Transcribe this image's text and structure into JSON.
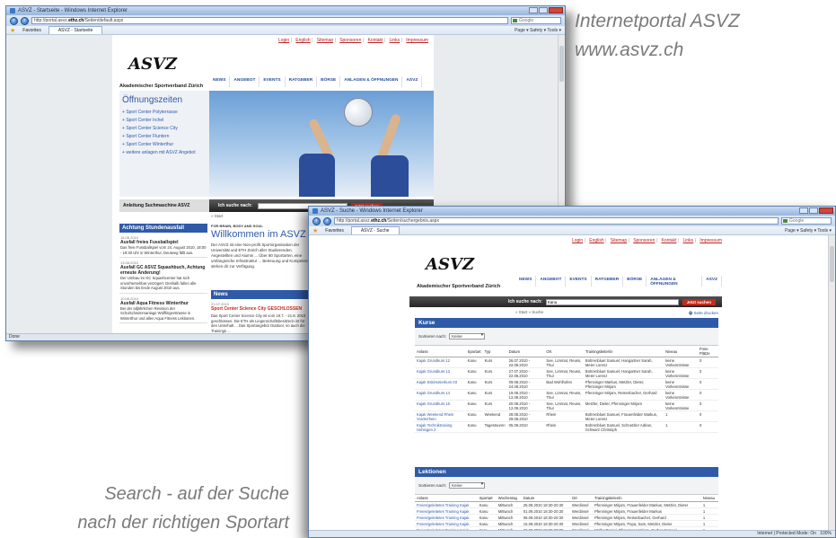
{
  "captions": {
    "top_line1": "Internetportal ASVZ",
    "top_line2": "www.asvz.ch",
    "bottom_line1": "Search - auf der Suche",
    "bottom_line2": "nach der richtigen Sportart"
  },
  "window1": {
    "title": "ASVZ - Startseite - Windows Internet Explorer",
    "url_prefix": "http://portal.asvz.",
    "url_domain": "ethz.ch",
    "url_suffix": "/Seiten/default.aspx",
    "search_placeholder": "Google",
    "favorites_label": "Favorites",
    "tab_label": "ASVZ - Startseite",
    "toolbar_tools": "Page ▾  Safety ▾  Tools ▾",
    "status": "Done",
    "page": {
      "toplinks": [
        "Login",
        "English",
        "Sitemap",
        "Sponsoren",
        "Kontakt",
        "Links",
        "Impressum"
      ],
      "logo": "ASVZ",
      "logo_sub": "Akademischer Sportverband Zürich",
      "nav": [
        "NEWS",
        "ANGEBOT",
        "EVENTS",
        "RATGEBER",
        "BÖRSE",
        "ANLAGEN & ÖFFNUNGEN",
        "ASVZ"
      ],
      "opening_title": "Öffnungszeiten",
      "opening_items": [
        "Sport Center Polyterrasse",
        "Sport Center Irchel",
        "Sport Center Science City",
        "Sport Center Fluntern",
        "Sport Center Winterthur",
        "weitere anlagen mit ASVZ Angebot"
      ],
      "announcement_label": "Anleitung Suchmaschine ASVZ",
      "search_label": "Ich suche nach:",
      "search_button": "Jetzt suchen",
      "breadcrumb": "» Start",
      "promo_small": "FOR BRAIN, BODY AND SOUL",
      "promo_title": "Willkommen im ASVZ",
      "promo_text": "Der ASVZ ist eine Non-profit Sportorganisation der Universität und ETH Zürich aller Studierenden. Angestellten und Alumni ... Über 80 Sportarten, eine umfangreiche Infrastruktur ... Betreuung und Kompetenz stehen dir zur Verfügung.",
      "notice_title": "Achtung Stundenausfall",
      "notices": [
        {
          "date": "18.08.2010",
          "title": "Ausfall freies Fussballspiel",
          "body": "Das freie Fussballspiel vom 24. August 2010, 18:00 - 19:30 Uhr in Winterthur, Deutweg fällt aus."
        },
        {
          "date": "13.08.2010",
          "title": "Ausfall GC ASVZ Squashbuch, Achtung erneute Änderung!",
          "body": "Der Umbau im GC Squashcenter hat sich unvorhersehbar verzögert. Deshalb fallen alle Stunden bis Ende August 2010 aus."
        },
        {
          "date": "10.08.2010",
          "title": "Ausfall Aqua Fitness Winterthur",
          "body": "Bei der alljährlichen Revision der Schulschwimmanlage Wülflingerstrasse in Winterthur und allen Aqua Fitness Lektionen."
        }
      ],
      "news_title": "News",
      "news_date": "21.07.2010",
      "news_headline": "Sport Center Science City GESCHLOSSEN",
      "news_text": "Das Sport Center Science City ist vom 19.7. - 21.8. 2010 geschlossen. Die ETH als Liegenschaftsbesitzerin ist für den Unterhalt ... Das Sportangebot Outdoor, so auch die Trainings ..."
    }
  },
  "window2": {
    "title": "ASVZ - Suche - Windows Internet Explorer",
    "url_prefix": "http://portal.asvz.",
    "url_domain": "ethz.ch",
    "url_suffix": "/Seiten/suchergebnis.aspx",
    "search_placeholder": "Google",
    "favorites_label": "Favorites",
    "tab_label": "ASVZ - Suche",
    "toolbar_tools": "Page ▾  Safety ▾  Tools ▾",
    "status": "Internet | Protected Mode: On",
    "zoom": "100%",
    "page": {
      "toplinks": [
        "Login",
        "English",
        "Sitemap",
        "Sponsoren",
        "Kontakt",
        "Links",
        "Impressum"
      ],
      "logo": "ASVZ",
      "logo_sub": "Akademischer Sportverband Zürich",
      "nav": [
        "NEWS",
        "ANGEBOT",
        "EVENTS",
        "RATGEBER",
        "BÖRSE",
        "ANLAGEN & ÖFFNUNGEN",
        "ASVZ"
      ],
      "search_label": "Ich suche nach:",
      "search_value": "Kanu",
      "search_button": "Jetzt suchen",
      "breadcrumb": "» Start » Suche",
      "print_label": "Seite drucken",
      "kurse_title": "Kurse",
      "sort_label": "Sortieren nach:",
      "sort_value": "Keine",
      "kurse_columns": [
        "Anlass",
        "Sportart",
        "Typ",
        "Datum",
        "Ort",
        "Trainingsleiter/in",
        "Niveau",
        "Freie Plätze"
      ],
      "kurse_rows": [
        [
          "Kajak Grundkurs 12",
          "Kanu",
          "Kurs",
          "26.07.2010 - 22.08.2010",
          "See, Limmat, Reuss, Thur",
          "Bohrenbluet Samuel, Hangartner Sarah, Meier Lorenz",
          "keine Vorkenntnisse",
          "0"
        ],
        [
          "Kajak Grundkurs 13",
          "Kanu",
          "Kurs",
          "27.07.2010 - 22.08.2010",
          "See, Limmat, Reuss, Thur",
          "Bohrenbluet Samuel, Hangartner Sarah, Meier Lorenz",
          "keine Vorkenntnisse",
          "0"
        ],
        [
          "Kajak Eskimotierkurs 03",
          "Kanu",
          "Kurs",
          "09.08.2010 - 24.08.2010",
          "Bad Wohlhofen",
          "Pfenninger Markus, Metzler, Dieter, Pfenninger Mirjam",
          "keine Vorkenntnisse",
          "0"
        ],
        [
          "Kajak Grundkurs 14",
          "Kanu",
          "Kurs",
          "19.08.2010 - 12.09.2010",
          "See, Limmat, Reuss, Thur",
          "Pfenninger Mirjam, Reisenbacher, Gerhard",
          "keine Vorkenntnisse",
          "0"
        ],
        [
          "Kajak Grundkurs 15",
          "Kanu",
          "Kurs",
          "20.08.2010 - 12.09.2010",
          "See, Limmat, Reuss, Thur",
          "Metzler, Dieter, Pfenninger Mirjam",
          "keine Vorkenntnisse",
          "0"
        ],
        [
          "Kajak Weekend Rhein Vorderrhein",
          "Kanu",
          "Weekend",
          "28.08.2010 - 29.08.2010",
          "Rhein",
          "Bohrenbluet Samuel, Frauenfelder Markus, Meier Lorenz",
          "1",
          "0"
        ],
        [
          "Kajak Techniktraining Hohingen 2",
          "Kanu",
          "Tagestouren",
          "05.09.2010",
          "Rhein",
          "Bohrenbluet Samuel, Schnetzler Adrian, Schwarz Christoph",
          "1",
          "0"
        ]
      ],
      "lektionen_title": "Lektionen",
      "lektionen_columns": [
        "Anlass",
        "Sportart",
        "Wochentag",
        "Datum",
        "Ort",
        "Trainingsleiter/in",
        "Niveau"
      ],
      "lektionen_rows": [
        [
          "Freies/geleitetes Training Kajak",
          "Kanu",
          "Mittwoch",
          "25.08.2010 18:30-20:30",
          "Werdinsel",
          "Pfenninger Mirjam, Frauenfelder Markus, Metzler, Dieter",
          "1"
        ],
        [
          "Freies/geleitetes Training Kajak",
          "Kanu",
          "Mittwoch",
          "01.09.2010 18:30-20:30",
          "Werdinsel",
          "Pfenninger Mirjam, Frauenfelder Markus",
          "1"
        ],
        [
          "Freies/geleitetes Training Kajak",
          "Kanu",
          "Mittwoch",
          "08.09.2010 18:30-20:30",
          "Werdinsel",
          "Pfenninger Mirjam, Reisenbacher, Gerhard",
          "1"
        ],
        [
          "Freies/geleitetes Training Kajak",
          "Kanu",
          "Mittwoch",
          "15.09.2010 18:30-20:30",
          "Werdinsel",
          "Pfenninger Mirjam, Popa, Sam, Metzler, Dieter",
          "1"
        ],
        [
          "Freies/geleitetes Training Kajak",
          "Kanu",
          "Mittwoch",
          "22.09.2010 18:30-20:30",
          "Werdinsel",
          "Müller Daniel, Pfenninger Mirjam, Gerber Samuel",
          "1"
        ]
      ]
    }
  },
  "colors": {
    "accent_blue": "#2f5aa8",
    "accent_red": "#c42b1e",
    "caption_gray": "#7a7a7a"
  }
}
